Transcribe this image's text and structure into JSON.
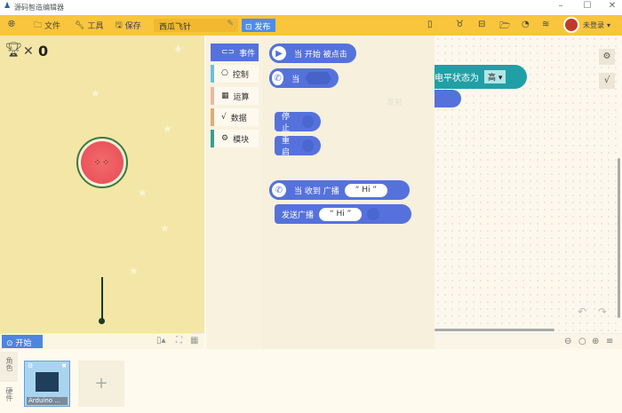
{
  "window": {
    "title": "源码智造编辑器",
    "controls": [
      "–",
      "☐",
      "✕"
    ]
  },
  "toolbar": {
    "file": "文件",
    "tools": "工具",
    "save": "保存",
    "project_name": "西瓜飞针",
    "publish": "发布",
    "user": "未登录"
  },
  "stage": {
    "score": "0",
    "start_button": "开始"
  },
  "categories": [
    {
      "label": "事件",
      "color": "#5572dc",
      "icon": "⊂⊃"
    },
    {
      "label": "控制",
      "color": "#5ec4ee",
      "icon": "🎮"
    },
    {
      "label": "运算",
      "color": "#f0b5a0",
      "icon": "▦"
    },
    {
      "label": "数据",
      "color": "#eaa866",
      "icon": "⁓√"
    },
    {
      "label": "模块",
      "color": "#26a69a",
      "icon": "⚙"
    }
  ],
  "blocks": {
    "when_start": "当 开始 被点击",
    "when": "当",
    "stop": "停止",
    "restart": "重启",
    "when_receive": "当 收到 广播",
    "receive_value": "“ Hi ”",
    "send_broadcast": "发送广播",
    "send_value": "“ Hi ”"
  },
  "workspace": {
    "pin_block_text": "电平状态为",
    "pin_level": "高",
    "ghost_value": "发射"
  },
  "assets": {
    "tab_role": "角色",
    "tab_hardware": "硬件",
    "device_name": "Arduino ...",
    "add": "+"
  }
}
